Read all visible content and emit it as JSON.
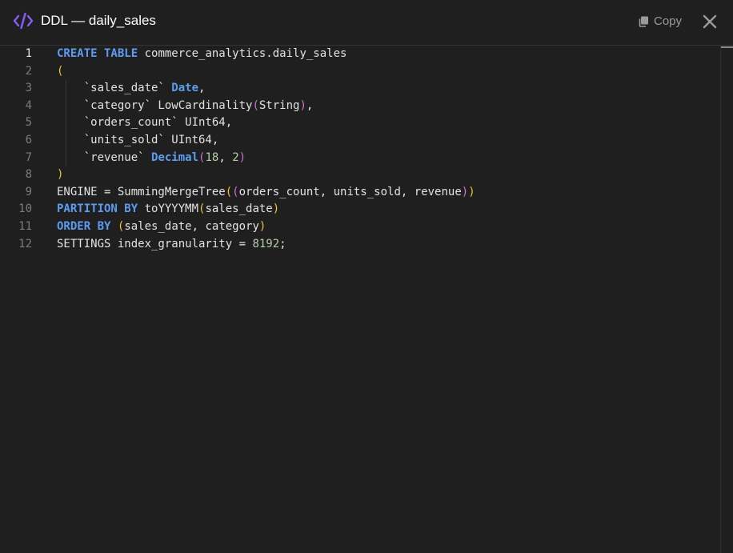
{
  "header": {
    "title": "DDL — daily_sales",
    "copy_label": "Copy",
    "icons": {
      "code": "code-brackets-icon",
      "copy": "copy-icon",
      "close": "close-icon"
    },
    "accent_color": "#8b5cf6"
  },
  "editor": {
    "active_line": 1,
    "line_numbers": [
      "1",
      "2",
      "3",
      "4",
      "5",
      "6",
      "7",
      "8",
      "9",
      "10",
      "11",
      "12"
    ],
    "lines": [
      [
        {
          "t": "CREATE TABLE",
          "c": "kw"
        },
        {
          "t": " commerce_analytics.daily_sales"
        }
      ],
      [
        {
          "t": "(",
          "c": "p1"
        }
      ],
      [
        {
          "t": "    `sales_date` "
        },
        {
          "t": "Date",
          "c": "tp"
        },
        {
          "t": ","
        }
      ],
      [
        {
          "t": "    `category` LowCardinality"
        },
        {
          "t": "(",
          "c": "p2"
        },
        {
          "t": "String"
        },
        {
          "t": ")",
          "c": "p2"
        },
        {
          "t": ","
        }
      ],
      [
        {
          "t": "    `orders_count` UInt64,"
        }
      ],
      [
        {
          "t": "    `units_sold` UInt64,"
        }
      ],
      [
        {
          "t": "    `revenue` "
        },
        {
          "t": "Decimal",
          "c": "tp"
        },
        {
          "t": "(",
          "c": "p2"
        },
        {
          "t": "18",
          "c": "num"
        },
        {
          "t": ", "
        },
        {
          "t": "2",
          "c": "num"
        },
        {
          "t": ")",
          "c": "p2"
        }
      ],
      [
        {
          "t": ")",
          "c": "p1"
        }
      ],
      [
        {
          "t": "ENGINE = SummingMergeTree"
        },
        {
          "t": "(",
          "c": "p1"
        },
        {
          "t": "(",
          "c": "p2"
        },
        {
          "t": "orders_count, units_sold, revenue"
        },
        {
          "t": ")",
          "c": "p2"
        },
        {
          "t": ")",
          "c": "p1"
        }
      ],
      [
        {
          "t": "PARTITION BY",
          "c": "kw"
        },
        {
          "t": " toYYYYMM"
        },
        {
          "t": "(",
          "c": "p1"
        },
        {
          "t": "sales_date"
        },
        {
          "t": ")",
          "c": "p1"
        }
      ],
      [
        {
          "t": "ORDER BY",
          "c": "kw"
        },
        {
          "t": " "
        },
        {
          "t": "(",
          "c": "p1"
        },
        {
          "t": "sales_date, category"
        },
        {
          "t": ")",
          "c": "p1"
        }
      ],
      [
        {
          "t": "SETTINGS index_granularity = "
        },
        {
          "t": "8192",
          "c": "num"
        },
        {
          "t": ";"
        }
      ]
    ]
  }
}
